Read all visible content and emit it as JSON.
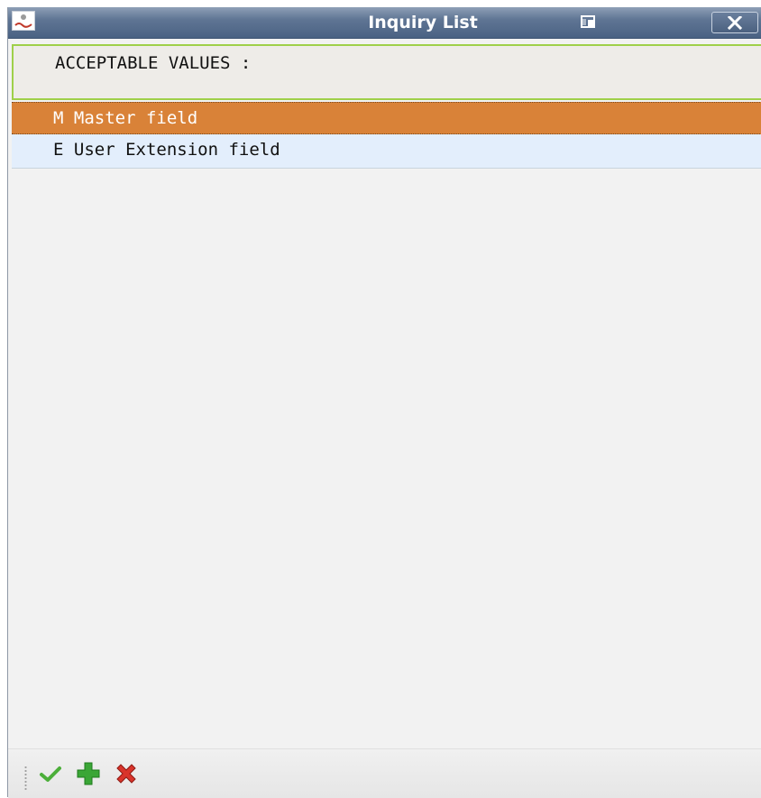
{
  "window": {
    "title": "Inquiry List"
  },
  "header": {
    "label": "ACCEPTABLE VALUES :"
  },
  "list": {
    "items": [
      {
        "label": "M Master field",
        "selected": true
      },
      {
        "label": "E User Extension field",
        "selected": false
      }
    ]
  },
  "toolbar": {
    "buttons": [
      {
        "icon": "check-icon",
        "color": "#4caf3a"
      },
      {
        "icon": "plus-icon",
        "color": "#3aa636"
      },
      {
        "icon": "delete-x-icon",
        "color": "#d9342b"
      }
    ]
  },
  "colors": {
    "titlebar": "#5f7594",
    "selected_row": "#d98238",
    "normal_row": "#e3eefc",
    "header_border": "#9fd04a"
  }
}
